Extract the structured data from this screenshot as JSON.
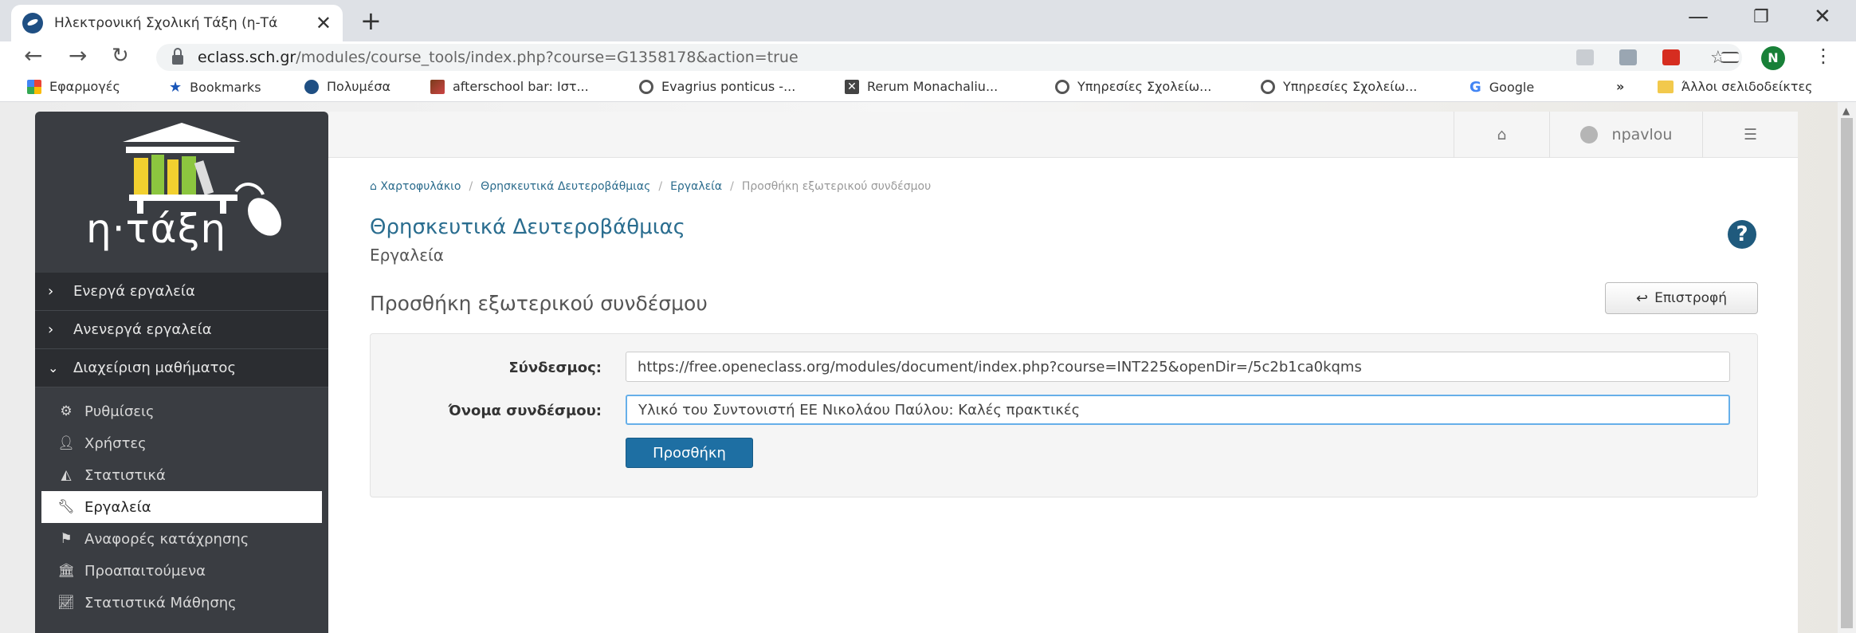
{
  "browser": {
    "tab_title": "Ηλεκτρονική Σχολική Τάξη (η-Τά",
    "url_host": "eclass.sch.gr",
    "url_path": "/modules/course_tools/index.php?course=G1358178&action=true",
    "profile_initial": "N",
    "bookmarks": [
      {
        "label": "Εφαρμογές",
        "icon": "apps-grid-icon"
      },
      {
        "label": "Bookmarks",
        "icon": "star-icon"
      },
      {
        "label": "Πολυμέσα",
        "icon": "eclass-icon"
      },
      {
        "label": "afterschool bar: Ιστ...",
        "icon": "image-icon"
      },
      {
        "label": "Evagrius ponticus -...",
        "icon": "globe-icon"
      },
      {
        "label": "Rerum Monachaliu...",
        "icon": "x-box-icon"
      },
      {
        "label": "Υπηρεσίες Σχολείω...",
        "icon": "globe-icon"
      },
      {
        "label": "Υπηρεσίες Σχολείω...",
        "icon": "globe-icon"
      },
      {
        "label": "Google",
        "icon": "google-icon"
      }
    ],
    "more_bookmarks": "»",
    "other_bookmarks": "Άλλοι σελιδοδείκτες"
  },
  "sidebar": {
    "logo_text": "η·τάξη",
    "sections": [
      {
        "label": "Ενεργά εργαλεία",
        "expanded": false
      },
      {
        "label": "Ανενεργά εργαλεία",
        "expanded": false
      },
      {
        "label": "Διαχείριση μαθήματος",
        "expanded": true
      }
    ],
    "items": [
      {
        "label": "Ρυθμίσεις",
        "icon": "cogs-icon"
      },
      {
        "label": "Χρήστες",
        "icon": "user-icon"
      },
      {
        "label": "Στατιστικά",
        "icon": "area-chart-icon"
      },
      {
        "label": "Εργαλεία",
        "icon": "wrench-icon",
        "active": true
      },
      {
        "label": "Αναφορές κατάχρησης",
        "icon": "flag-icon"
      },
      {
        "label": "Προαπαιτούμενα",
        "icon": "bank-icon"
      },
      {
        "label": "Στατιστικά Μάθησης",
        "icon": "line-chart-icon"
      }
    ]
  },
  "topbar": {
    "username": "npavlou"
  },
  "breadcrumb": {
    "items": [
      "Χαρτοφυλάκιο",
      "Θρησκευτικά Δευτεροβάθμιας",
      "Εργαλεία"
    ],
    "current": "Προσθήκη εξωτερικού συνδέσμου"
  },
  "course": {
    "title": "Θρησκευτικά Δευτεροβάθμιας",
    "subtitle": "Εργαλεία"
  },
  "page": {
    "title": "Προσθήκη εξωτερικού συνδέσμου",
    "back_label": "Επιστροφή",
    "help_label": "?"
  },
  "form": {
    "link_label": "Σύνδεσμος:",
    "link_value": "https://free.openeclass.org/modules/document/index.php?course=INT225&openDir=/5c2b1ca0kqms",
    "name_label": "Όνομα συνδέσμου:",
    "name_value": "Υλικό του Συντονιστή ΕΕ Νικολάου Παύλου: Καλές πρακτικές",
    "submit_label": "Προσθήκη"
  },
  "colors": {
    "sidebar_bg": "#3a3d42",
    "accent": "#2a6d8f",
    "primary_button": "#1e6fa3"
  }
}
